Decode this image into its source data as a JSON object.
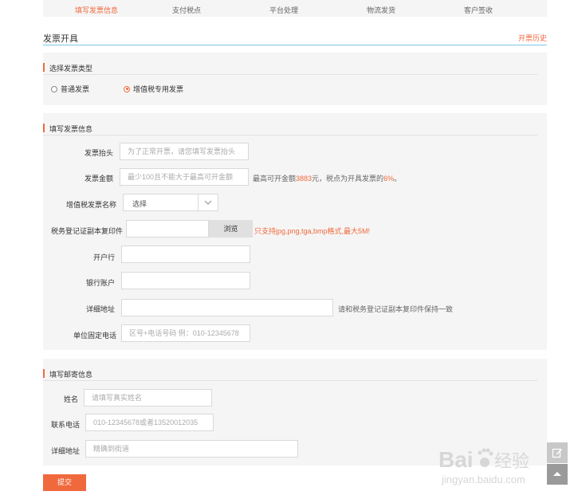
{
  "steps": [
    "填写发票信息",
    "支付税点",
    "平台处理",
    "物流发货",
    "客户签收"
  ],
  "page": {
    "title": "发票开具",
    "history_link": "开票历史"
  },
  "invoice_type": {
    "heading": "选择发票类型",
    "options": [
      "普通发票",
      "增值税专用发票"
    ],
    "selected": "增值税专用发票"
  },
  "invoice_info": {
    "heading": "填写发票信息",
    "title_label": "发票抬头",
    "title_placeholder": "为了正常开票，请您填写发票抬头",
    "amount_label": "发票金额",
    "amount_placeholder": "最少100且不能大于最高可开金额",
    "amount_hint_prefix": "最高可开金额",
    "amount_max": "3883",
    "amount_hint_middle": "元，税点为开具发票的",
    "tax_rate": "6%",
    "amount_hint_suffix": "。",
    "vat_name_label": "增值税发票名称",
    "vat_name_value": "选择",
    "tax_cert_label": "税务登记证副本复印件",
    "browse_label": "浏览",
    "file_warning": "只支持jpg,png,tga,bmp格式,最大5M!",
    "bank_label": "开户行",
    "account_label": "银行账户",
    "address_label": "详细地址",
    "address_hint": "请和税务登记证副本复印件保持一致",
    "phone_label": "单位固定电话",
    "phone_placeholder": "区号+电话号码 例：010-12345678"
  },
  "mailing_info": {
    "heading": "填写邮寄信息",
    "name_label": "姓名",
    "name_placeholder": "请填写真实姓名",
    "phone_label": "联系电话",
    "phone_placeholder": "010-12345678或者13520012035",
    "address_label": "详细地址",
    "address_placeholder": "精确到街道"
  },
  "submit_label": "提交",
  "watermark": {
    "brand": "Baidu经验",
    "url": "jingyan.baidu.com"
  },
  "colors": {
    "accent": "#f0693d",
    "title_line": "#7cc6e6",
    "panel_bg": "#f5f5f5"
  }
}
